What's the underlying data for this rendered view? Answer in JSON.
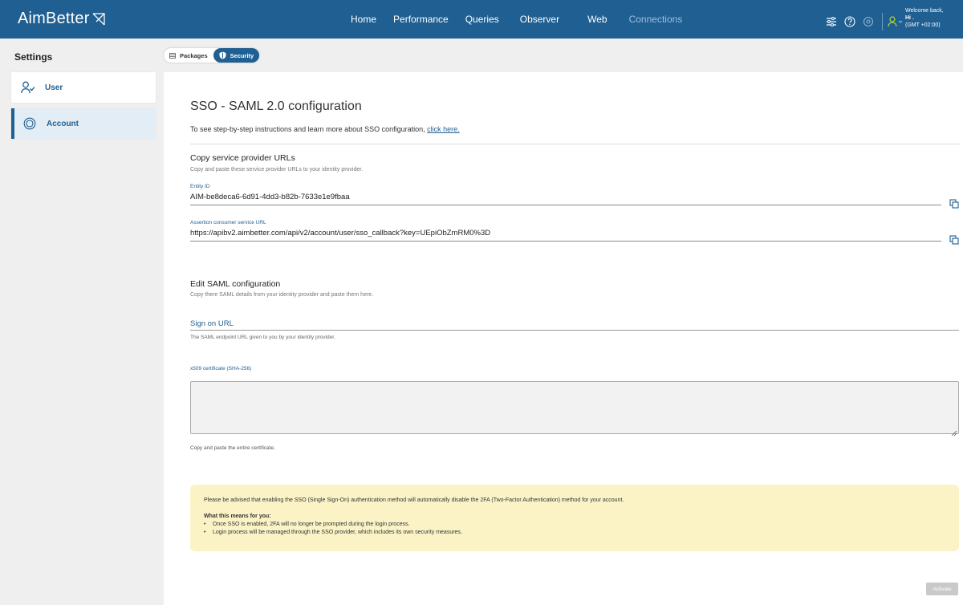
{
  "app": {
    "logo_text": "AimBetter",
    "brand_color": "#1f5f92"
  },
  "nav": {
    "items": [
      {
        "label": "Home"
      },
      {
        "label": "Performance"
      },
      {
        "label": "Queries"
      },
      {
        "label": "Observer"
      },
      {
        "label": "Web"
      },
      {
        "label": "Connections"
      }
    ]
  },
  "user": {
    "welcome": "Welcome back,",
    "name": "Hi .",
    "timezone": "(GMT +02:00)"
  },
  "sidebar": {
    "title": "Settings",
    "items": [
      {
        "label": "User",
        "icon": "user-check-icon"
      },
      {
        "label": "Account",
        "icon": "account-circle-icon"
      }
    ]
  },
  "tabs": {
    "packages": "Packages",
    "security": "Security"
  },
  "sso": {
    "title": "SSO - SAML 2.0 configuration",
    "intro_text": "To see step-by-step instructions and learn more about SSO configuration, ",
    "intro_link": "click here.",
    "sp": {
      "heading": "Copy service provider URLs",
      "sub": "Copy and paste these service provider URLs to your identity provider.",
      "entity_label": "Entity ID",
      "entity_value": "AIM-be8deca6-6d91-4dd3-b82b-7633e1e9fbaa",
      "acs_label": "Assertion consumer service URL",
      "acs_value": "https://apibv2.aimbetter.com/api/v2/account/user/sso_callback?key=UEpiObZmRM0%3D"
    },
    "edit": {
      "heading": "Edit SAML configuration",
      "sub": "Copy there SAML details from your identity provider and paste them here.",
      "sign_on_label": "Sign on URL",
      "sign_on_help": "The SAML endpoint URL given to you by your identity provider.",
      "cert_label": "x509 certificate (SHA-256)",
      "cert_value": "",
      "cert_help": "Copy and paste the entire certificate."
    },
    "notice": {
      "text": "Please be advised that enabling the SSO (Single Sign-On) authentication method will automatically disable the 2FA (Two-Factor Authentication) method for your account.",
      "means_title": "What this means for you:",
      "bullets": [
        "Once SSO is enabled, 2FA will no longer be prompted during the login process.",
        "Login process will be managed through the SSO provider, which includes its own security measures."
      ]
    },
    "activate_label": "Activate"
  }
}
